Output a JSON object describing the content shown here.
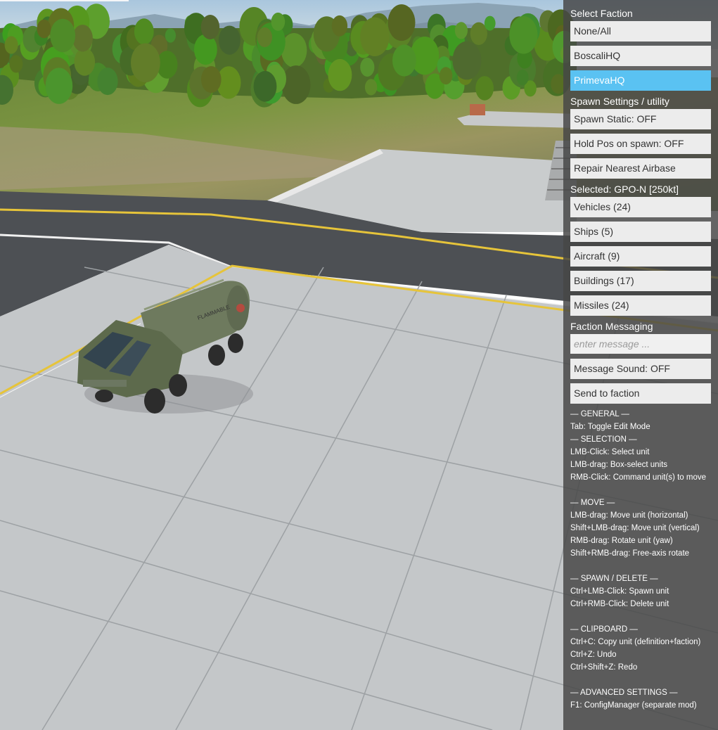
{
  "panel": {
    "faction_header": "Select Faction",
    "factions": [
      "None/All",
      "BoscaliHQ",
      "PrimevaHQ"
    ],
    "active_faction_index": 2,
    "spawn_header": "Spawn Settings / utility",
    "spawn_buttons": [
      "Spawn Static: OFF",
      "Hold Pos on spawn: OFF",
      "Repair Nearest Airbase"
    ],
    "selected_header": "Selected: GPO-N [250kt]",
    "categories": [
      "Vehicles (24)",
      "Ships (5)",
      "Aircraft (9)",
      "Buildings (17)",
      "Missiles (24)"
    ],
    "messaging_header": "Faction Messaging",
    "message_placeholder": "enter message ...",
    "message_sound": "Message Sound: OFF",
    "send_button": "Send to faction",
    "help": [
      "— GENERAL —",
      "Tab: Toggle Edit Mode",
      "— SELECTION —",
      "LMB-Click: Select unit",
      "LMB-drag: Box-select units",
      "RMB-Click: Command unit(s) to move",
      "",
      "— MOVE —",
      "LMB-drag: Move unit (horizontal)",
      "Shift+LMB-drag: Move unit (vertical)",
      "RMB-drag: Rotate unit (yaw)",
      "Shift+RMB-drag: Free-axis rotate",
      "",
      "— SPAWN / DELETE —",
      "Ctrl+LMB-Click: Spawn unit",
      "Ctrl+RMB-Click: Delete unit",
      "",
      "— CLIPBOARD —",
      "Ctrl+C: Copy unit (definition+faction)",
      "Ctrl+Z: Undo",
      "Ctrl+Shift+Z: Redo",
      "",
      "— ADVANCED SETTINGS —",
      "F1: ConfigManager (separate mod)"
    ]
  },
  "scene": {
    "tanker_label": "FLAMMABLE",
    "colors": {
      "active_button": "#5ac2f2",
      "panel_bg": "#464646",
      "taxi_line": "#e6c43a",
      "tanker_body": "#6e7a5e"
    }
  }
}
